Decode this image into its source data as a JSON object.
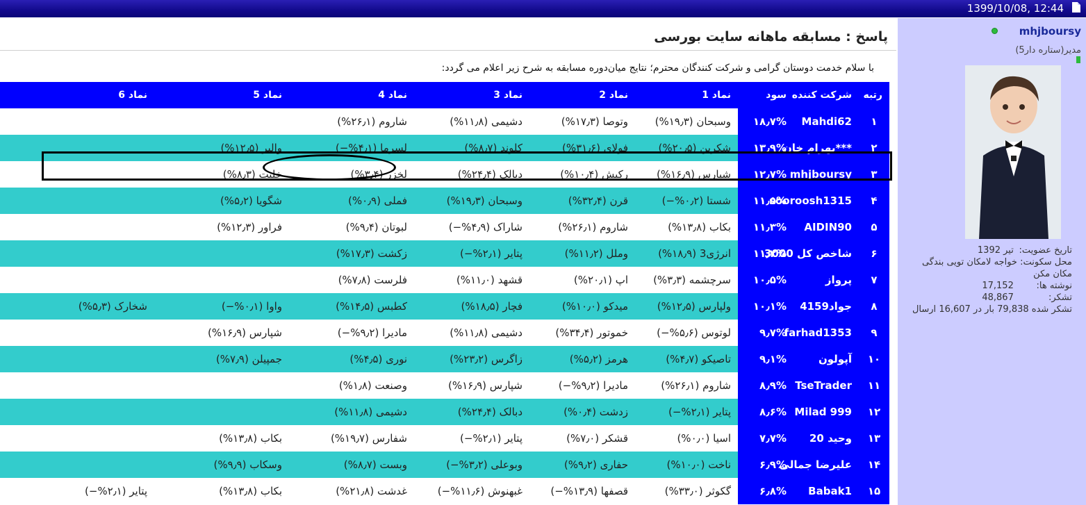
{
  "topbar": {
    "datetime": "1399/10/08, 12:44"
  },
  "sidebar": {
    "username": "mhjboursy",
    "role": "مدیر(ستاره دار5)",
    "stats": [
      {
        "key": "تاریخ عضویت:",
        "value": "تیر 1392"
      },
      {
        "key": "محل سکونت:",
        "value": "خواجه لامکان تویی بندگی مکان مکن"
      },
      {
        "key": "نوشته ها:",
        "value": "17,152"
      },
      {
        "key": "تشکر:",
        "value": "48,867"
      }
    ],
    "thanks_line": "تشکر شده 79,838 بار در 16,607 ارسال"
  },
  "post": {
    "title": "پاسخ : مسابقه ماهانه سایت بورسی",
    "intro": "با سلام خدمت دوستان گرامی و شرکت کنندگان محترم؛ نتایج میان‌دوره مسابقه به شرح زیر اعلام می گردد:"
  },
  "table": {
    "headers": [
      "رتبه",
      "شرکت کننده",
      "سود",
      "نماد 1",
      "نماد 2",
      "نماد 3",
      "نماد 4",
      "نماد 5",
      "نماد 6"
    ],
    "rows": [
      [
        "۱",
        "Mahdi62",
        "۱۸٫۷%",
        "وسبحان (۱۹٫۳%)",
        "وتوصا (۱۷٫۳%)",
        "دشیمی (۱۱٫۸%)",
        "شاروم (۲۶٫۱%)",
        "",
        ""
      ],
      [
        "۲",
        "***بهرام خان",
        "۱۳٫۹%",
        "شکربن (۲۰٫۵%)",
        "فولای (۳۱٫۶%)",
        "کلوند (۸٫۷%)",
        "لسرما (۴٫۱%−)",
        "والبر (۱۲٫۵%)",
        ""
      ],
      [
        "۳",
        "mhjboursy",
        "۱۲٫۷%",
        "شپارس (۱۶٫۹%)",
        "رکیش (۱۰٫۴%)",
        "دبالک (۲۴٫۴%)",
        "لخزر (۳٫۴%)",
        "خلنت (۸٫۳%)",
        ""
      ],
      [
        "۴",
        "sooroosh1315",
        "۱۱٫۵%",
        "شستا (۰٫۲%−)",
        "قرن (۳۲٫۴%)",
        "وسبحان (۱۹٫۳%)",
        "فملی (۰٫۹%)",
        "شگویا (۵٫۲%)",
        ""
      ],
      [
        "۵",
        "AIDIN90",
        "۱۱٫۳%",
        "بکاب (۱۳٫۸%)",
        "شاروم (۲۶٫۱%)",
        "شاراک (۴٫۹%−)",
        "لبوتان (۹٫۴%)",
        "فراور (۱۲٫۳%)",
        ""
      ],
      [
        "۶",
        "شاخص کل 3000",
        "۱۱٫۳%",
        "انرژی3 (۱۸٫۹%)",
        "وملل (۱۱٫۲%)",
        "پتایر (۲٫۱%−)",
        "زکشت (۱۷٫۳%)",
        "",
        ""
      ],
      [
        "۷",
        "پرواز",
        "۱۰٫۵%",
        "سرچشمه (۳٫۳%)",
        "اپ (۲۰٫۱%)",
        "قشهد (۱۱٫۰%)",
        "فلرست (۷٫۸%)",
        "",
        ""
      ],
      [
        "۸",
        "جواد4159",
        "۱۰٫۱%",
        "ولپارس (۱۲٫۵%)",
        "میدکو (۱۰٫۰%)",
        "فچار (۱۸٫۵%)",
        "کطبس (۱۴٫۵%)",
        "واوا (۰٫۱%−)",
        "شخارک (۵٫۳%)"
      ],
      [
        "۹",
        "farhad1353",
        "۹٫۷%",
        "لوتوس (۵٫۶%−)",
        "خموتور (۳۴٫۴%)",
        "دشیمی (۱۱٫۸%)",
        "مادیرا (۹٫۲%−)",
        "شپارس (۱۶٫۹%)",
        ""
      ],
      [
        "۱۰",
        "آپولون",
        "۹٫۱%",
        "تاصیکو (۴٫۷%)",
        "هرمز (۵٫۲%)",
        "زاگرس (۲۳٫۲%)",
        "نوری (۴٫۵%)",
        "جمپیلن (۷٫۹%)",
        ""
      ],
      [
        "۱۱",
        "TseTrader",
        "۸٫۹%",
        "شاروم (۲۶٫۱%)",
        "مادیرا (۹٫۲%−)",
        "شپارس (۱۶٫۹%)",
        "وصنعت (۱٫۸%)",
        "",
        ""
      ],
      [
        "۱۲",
        "Milad 999",
        "۸٫۶%",
        "پتایر (۲٫۱%−)",
        "زدشت (۰٫۴%)",
        "دبالک (۲۴٫۴%)",
        "دشیمی (۱۱٫۸%)",
        "",
        ""
      ],
      [
        "۱۳",
        "وحید 20",
        "۷٫۷%",
        "اسیا (۰٫۰%)",
        "قشکر (۷٫۰%)",
        "پتایر (۲٫۱%−)",
        "شفارس (۱۹٫۷%)",
        "بکاب (۱۳٫۸%)",
        ""
      ],
      [
        "۱۴",
        "علیرضا جمالی",
        "۶٫۹%",
        "ناخت (۱۰٫۰%)",
        "حفاری (۹٫۲%)",
        "وبوعلی (۳٫۲%−)",
        "وبست (۸٫۷%)",
        "وسکاب (۹٫۹%)",
        ""
      ],
      [
        "۱۵",
        "Babak1",
        "۶٫۸%",
        "گکوثر (۳۳٫۰%)",
        "قصفها (۱۳٫۹%−)",
        "غبهنوش (۱۱٫۶%−)",
        "غدشت (۲۱٫۸%)",
        "بکاب (۱۳٫۸%)",
        "پتایر (۲٫۱%−)"
      ]
    ]
  }
}
